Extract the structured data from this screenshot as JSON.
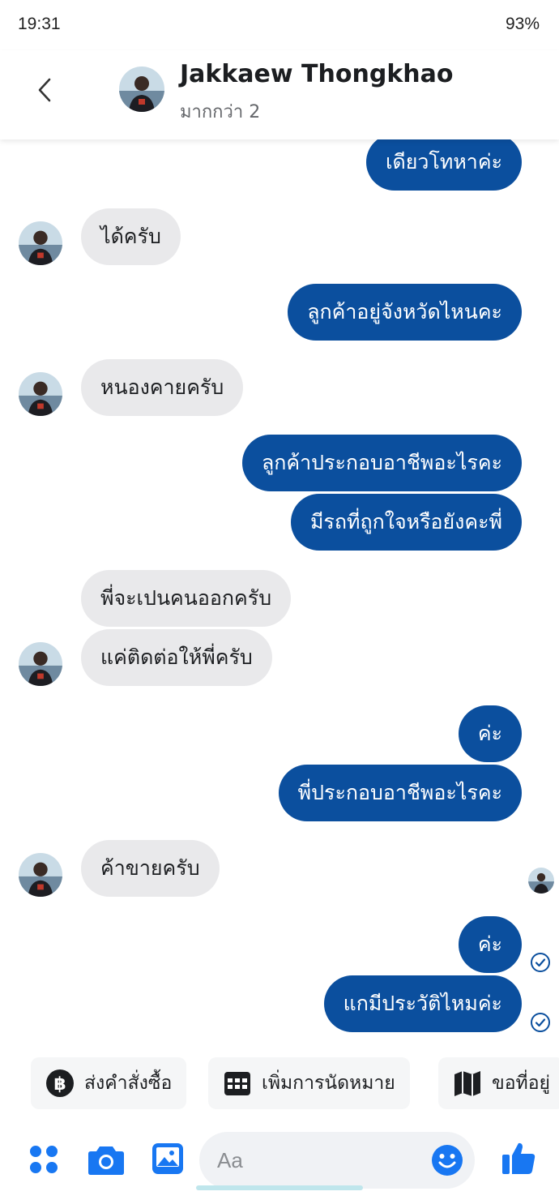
{
  "status": {
    "time": "19:31",
    "battery": "93%"
  },
  "header": {
    "name": "Jakkaew Thongkhao",
    "subtitle": "มากกว่า 2",
    "back_icon": "chevron-left-icon"
  },
  "messages": {
    "m0": "เดียวโทหาค่ะ",
    "m1": "ได้ครับ",
    "m2": "ลูกค้าอยู่จังหวัดไหนคะ",
    "m3": "หนองคายครับ",
    "m4": "ลูกค้าประกอบอาชีพอะไรคะ",
    "m5": "มีรถที่ถูกใจหรือยังคะพี่",
    "m6": "พี่จะเปนคนออกครับ",
    "m7": "แค่ติดต่อให้พี่ครับ",
    "m8": "ค่ะ",
    "m9": "พี่ประกอบอาชีพอะไรคะ",
    "m10": "ค้าขายครับ",
    "m11": "ค่ะ",
    "m12": "แกมีประวัติไหมค่ะ"
  },
  "quick_actions": {
    "order": "ส่งคำสั่งซื้อ",
    "appointment": "เพิ่มการนัดหมาย",
    "location": "ขอที่อยู่"
  },
  "composer": {
    "placeholder": "Aa"
  },
  "colors": {
    "outgoing": "#0b4f9e",
    "incoming": "#e9e9eb",
    "accent": "#1877f2"
  }
}
